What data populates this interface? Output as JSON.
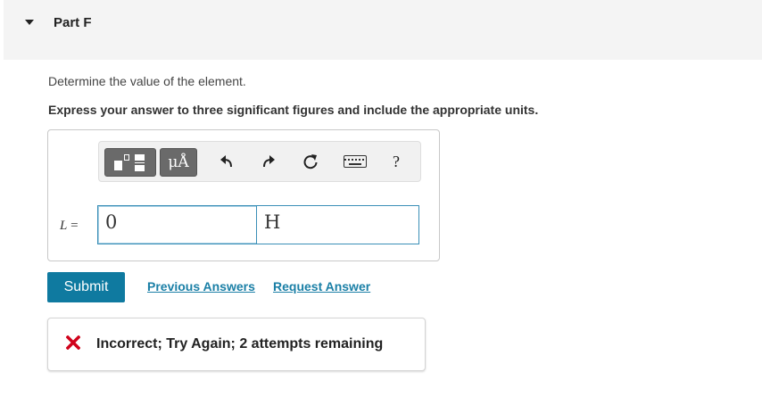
{
  "part": {
    "title": "Part F"
  },
  "question": {
    "prompt": "Determine the value of the element.",
    "instruction": "Express your answer to three significant figures and include the appropriate units."
  },
  "toolbar": {
    "units_label": "μÅ",
    "help_label": "?",
    "icons": [
      "templates-icon",
      "units-icon",
      "undo-icon",
      "redo-icon",
      "reset-icon",
      "keyboard-icon",
      "help-icon"
    ]
  },
  "answer": {
    "variable": "L",
    "equals": "=",
    "value": "0",
    "unit": "H"
  },
  "actions": {
    "submit_label": "Submit",
    "previous_answers_label": "Previous Answers",
    "request_answer_label": "Request Answer"
  },
  "feedback": {
    "message": "Incorrect; Try Again; 2 attempts remaining",
    "status_color": "#d0021b"
  },
  "colors": {
    "accent": "#0f7aa0",
    "link": "#1a7fa6",
    "input_border": "#3a8fb7"
  }
}
